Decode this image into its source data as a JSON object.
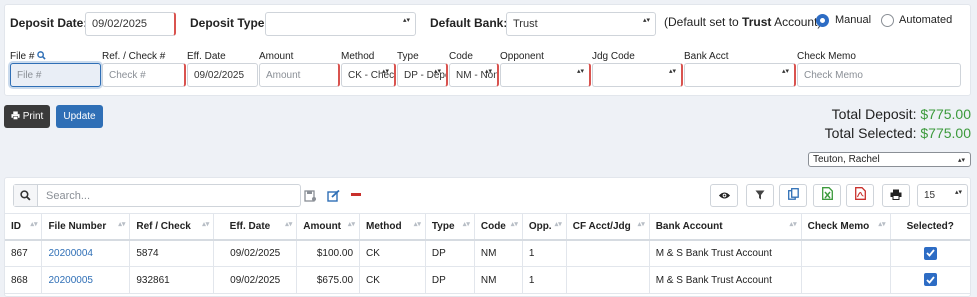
{
  "header": {
    "deposit_date_label": "Deposit Date:",
    "deposit_date_value": "09/02/2025",
    "deposit_type_label": "Deposit Type:",
    "deposit_type_value": "",
    "default_bank_label": "Default Bank:",
    "default_bank_value": "Trust",
    "default_note_pre": "(Default set to ",
    "default_note_bold": "Trust",
    "default_note_post": " Account)",
    "radio_manual": "Manual",
    "radio_automated": "Automated",
    "selected_mode": "Manual"
  },
  "entry": {
    "labels": {
      "file": "File #",
      "ref": "Ref. / Check #",
      "eff": "Eff. Date",
      "amount": "Amount",
      "method": "Method",
      "type": "Type",
      "code": "Code",
      "opponent": "Opponent",
      "jdg": "Jdg Code",
      "bank": "Bank Acct",
      "memo": "Check Memo"
    },
    "file_placeholder": "File #",
    "ref_placeholder": "Check #",
    "eff_value": "09/02/2025",
    "amount_placeholder": "Amount",
    "method_value": "CK - Check",
    "type_value": "DP - Deposit",
    "code_value": "NM - None",
    "opponent_value": "",
    "jdg_value": "",
    "bank_value": "",
    "memo_placeholder": "Check Memo"
  },
  "actions": {
    "print_label": "Print",
    "update_label": "Update"
  },
  "totals": {
    "deposit_label": "Total Deposit: ",
    "deposit_value": "$775.00",
    "selected_label": "Total Selected: ",
    "selected_value": "$775.00",
    "user_select": "Teuton, Rachel"
  },
  "table": {
    "search_placeholder": "Search...",
    "page_size": "15",
    "columns": [
      "ID",
      "File Number",
      "Ref / Check",
      "Eff. Date",
      "Amount",
      "Method",
      "Type",
      "Code",
      "Opp.",
      "CF Acct/Jdg",
      "Bank Account",
      "Check Memo",
      "Selected?"
    ],
    "rows": [
      {
        "id": "867",
        "file": "20200004",
        "ref": "5874",
        "date": "09/02/2025",
        "amount": "$100.00",
        "method": "CK",
        "type": "DP",
        "code": "NM",
        "opp": "1",
        "cf": "",
        "bank": "M & S Bank Trust Account",
        "memo": "",
        "selected": true
      },
      {
        "id": "868",
        "file": "20200005",
        "ref": "932861",
        "date": "09/02/2025",
        "amount": "$675.00",
        "method": "CK",
        "type": "DP",
        "code": "NM",
        "opp": "1",
        "cf": "",
        "bank": "M & S Bank Trust Account",
        "memo": "",
        "selected": true
      }
    ]
  },
  "colors": {
    "accent": "#2d6cc4",
    "required": "#d9534f",
    "total_green": "#3c9a3c",
    "print_btn": "#3a3a3a"
  }
}
